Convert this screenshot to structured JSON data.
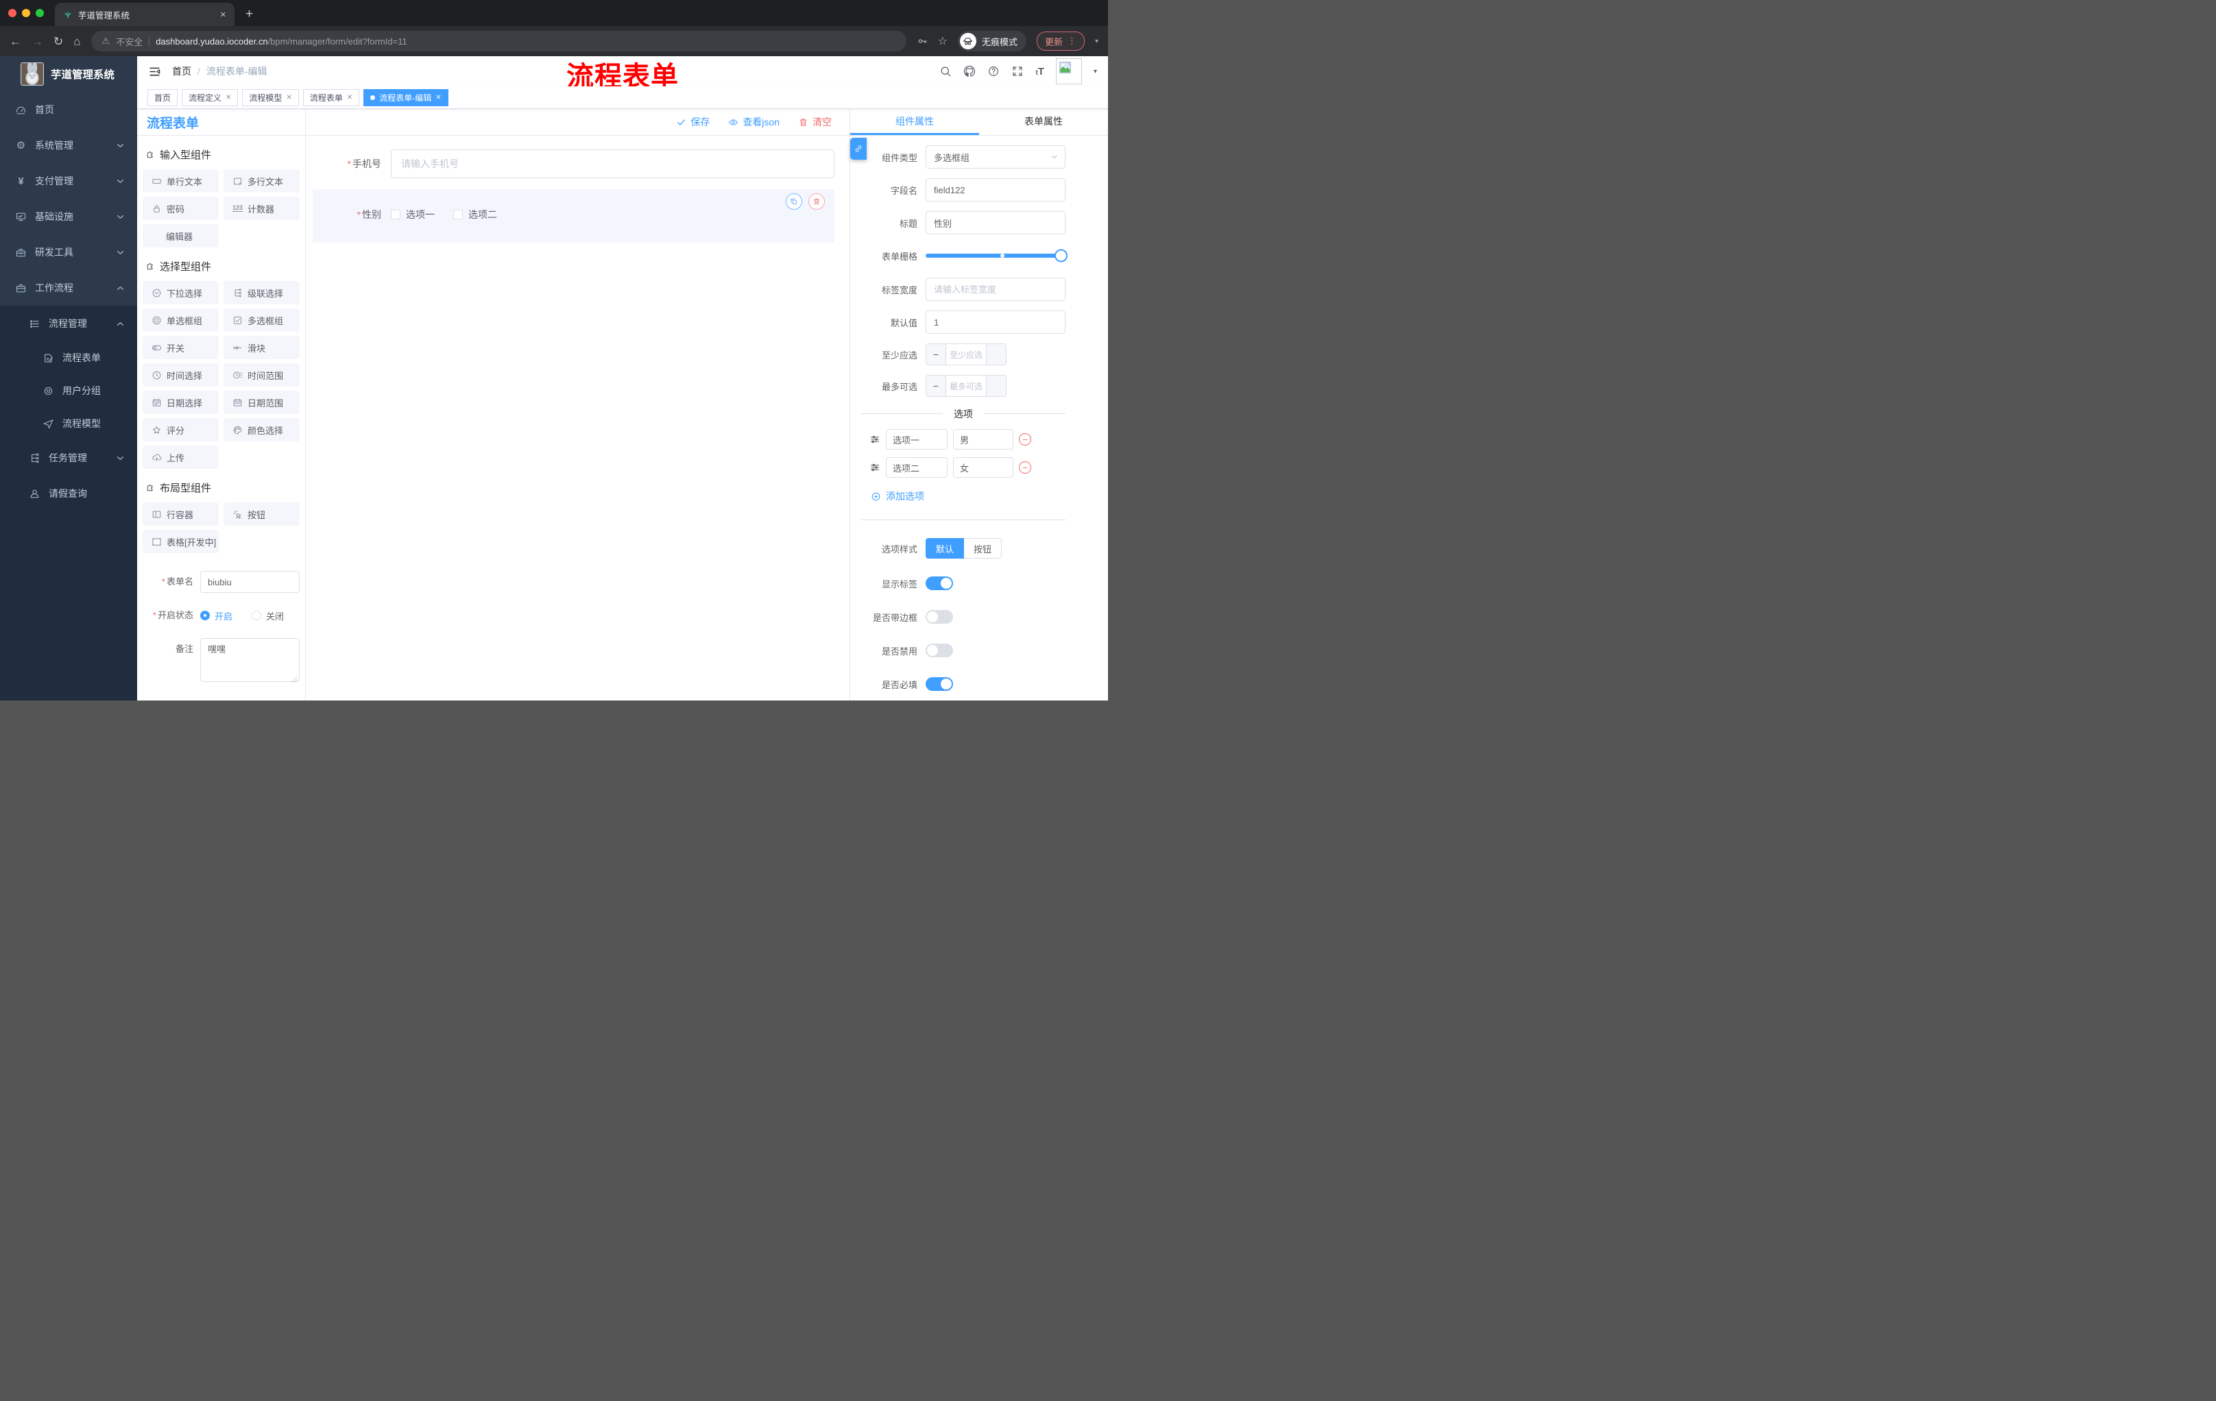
{
  "colors": {
    "accent": "#409eff",
    "danger": "#f56c6c",
    "annotation_red": "#fe0000",
    "sidebar_bg": "#2d3a4b",
    "sidebar_submenu_bg": "#212d3e",
    "chip_bg": "#f4f6fc",
    "selected_block_bg": "#f4f6fe"
  },
  "icons": {
    "back": "←",
    "forward": "→",
    "reload": "↻",
    "home": "⌂",
    "warning": "⚠",
    "star": "☆",
    "kebab": "⋮",
    "caret": "▾",
    "close": "✕",
    "newtab": "+",
    "gear": "⚙",
    "yen": "¥",
    "counter": "123",
    "fontsize_small": "t",
    "fontsize_big": "T",
    "asterisk": "*",
    "minus": "−",
    "slash": "/"
  },
  "browser": {
    "tab_title": "芋道管理系统",
    "security": "不安全",
    "url_host": "dashboard.yudao.iocoder.cn",
    "url_path": "/bpm/manager/form/edit?formId=11",
    "incognito": "无痕模式",
    "update": "更新"
  },
  "sidebar": {
    "title": "芋道管理系统",
    "menu": [
      {
        "label": "首页"
      },
      {
        "label": "系统管理"
      },
      {
        "label": "支付管理"
      },
      {
        "label": "基础设施"
      },
      {
        "label": "研发工具"
      },
      {
        "label": "工作流程"
      },
      {
        "label": "流程管理"
      },
      {
        "label": "流程表单"
      },
      {
        "label": "用户分组"
      },
      {
        "label": "流程模型"
      },
      {
        "label": "任务管理"
      },
      {
        "label": "请假查询"
      }
    ]
  },
  "header": {
    "breadcrumb_home": "首页",
    "breadcrumb_current": "流程表单-编辑",
    "annotation": "流程表单"
  },
  "pagetabs": [
    {
      "label": "首页"
    },
    {
      "label": "流程定义"
    },
    {
      "label": "流程模型"
    },
    {
      "label": "流程表单"
    },
    {
      "label": "流程表单-编辑"
    }
  ],
  "palette": {
    "title": "流程表单",
    "groups": [
      {
        "title": "输入型组件",
        "items": [
          {
            "label": "单行文本"
          },
          {
            "label": "多行文本"
          },
          {
            "label": "密码"
          },
          {
            "label": "计数器"
          },
          {
            "label": "编辑器"
          }
        ]
      },
      {
        "title": "选择型组件",
        "items": [
          {
            "label": "下拉选择"
          },
          {
            "label": "级联选择"
          },
          {
            "label": "单选框组"
          },
          {
            "label": "多选框组"
          },
          {
            "label": "开关"
          },
          {
            "label": "滑块"
          },
          {
            "label": "时间选择"
          },
          {
            "label": "时间范围"
          },
          {
            "label": "日期选择"
          },
          {
            "label": "日期范围"
          },
          {
            "label": "评分"
          },
          {
            "label": "颜色选择"
          },
          {
            "label": "上传"
          }
        ]
      },
      {
        "title": "布局型组件",
        "items": [
          {
            "label": "行容器"
          },
          {
            "label": "按钮"
          },
          {
            "label": "表格[开发中]"
          }
        ]
      }
    ],
    "form": {
      "name_label": "表单名",
      "name_value": "biubiu",
      "status_label": "开启状态",
      "status_on": "开启",
      "status_off": "关闭",
      "remark_label": "备注",
      "remark_value": "嘿嘿"
    }
  },
  "canvas": {
    "toolbar": {
      "save": "保存",
      "view_json": "查看json",
      "clear": "清空"
    },
    "phone": {
      "label": "手机号",
      "placeholder": "请输入手机号"
    },
    "gender": {
      "label": "性别",
      "options": [
        {
          "label": "选项一"
        },
        {
          "label": "选项二"
        }
      ]
    }
  },
  "inspector": {
    "tab_component": "组件属性",
    "tab_form": "表单属性",
    "rows": {
      "type_label": "组件类型",
      "type_value": "多选框组",
      "field_label": "字段名",
      "field_value": "field122",
      "title_label": "标题",
      "title_value": "性别",
      "grid_label": "表单栅格",
      "labelwidth_label": "标签宽度",
      "labelwidth_placeholder": "请输入标签宽度",
      "default_label": "默认值",
      "default_value": "1",
      "min_label": "至少应选",
      "min_placeholder": "至少应选",
      "max_label": "最多可选",
      "max_placeholder": "最多可选"
    },
    "options_divider": "选项",
    "options": [
      {
        "name": "选项一",
        "value": "男"
      },
      {
        "name": "选项二",
        "value": "女"
      }
    ],
    "add_option": "添加选项",
    "style_label": "选项样式",
    "style_default": "默认",
    "style_button": "按钮",
    "toggles": [
      {
        "label": "显示标签",
        "on": true
      },
      {
        "label": "是否带边框",
        "on": false
      },
      {
        "label": "是否禁用",
        "on": false
      },
      {
        "label": "是否必填",
        "on": true
      }
    ]
  }
}
